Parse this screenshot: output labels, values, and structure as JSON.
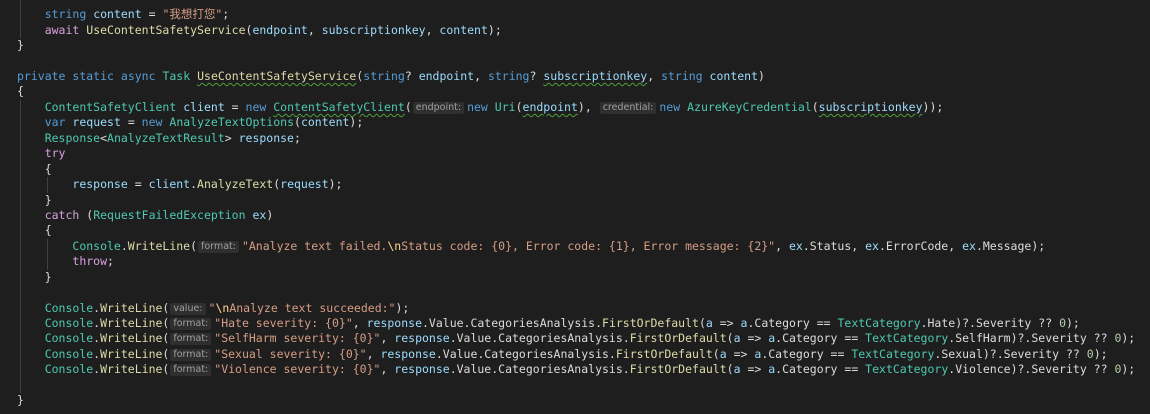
{
  "theme": {
    "background": "#1E1E1E",
    "indent_guide": "#404040",
    "hint_background": "#2F2F2F",
    "hint_text": "#A0A0A0"
  },
  "code": {
    "lines": [
      {
        "tokens": [
          {
            "t": "    ",
            "c": "#DCDCDC"
          },
          {
            "t": "string",
            "c": "#569CD6"
          },
          {
            "t": " ",
            "c": "#DCDCDC"
          },
          {
            "t": "content",
            "c": "#9CDCFE"
          },
          {
            "t": " = ",
            "c": "#DCDCDC"
          },
          {
            "t": "\"我想打您\"",
            "c": "#D69D85"
          },
          {
            "t": ";",
            "c": "#DCDCDC"
          }
        ]
      },
      {
        "tokens": [
          {
            "t": "    ",
            "c": "#DCDCDC"
          },
          {
            "t": "await",
            "c": "#D8A0DF"
          },
          {
            "t": " ",
            "c": "#DCDCDC"
          },
          {
            "t": "UseContentSafetyService",
            "c": "#DCDCAA"
          },
          {
            "t": "(",
            "c": "#DCDCDC"
          },
          {
            "t": "endpoint",
            "c": "#9CDCFE"
          },
          {
            "t": ", ",
            "c": "#DCDCDC"
          },
          {
            "t": "subscriptionkey",
            "c": "#9CDCFE"
          },
          {
            "t": ", ",
            "c": "#DCDCDC"
          },
          {
            "t": "content",
            "c": "#9CDCFE"
          },
          {
            "t": ");",
            "c": "#DCDCDC"
          }
        ]
      },
      {
        "tokens": [
          {
            "t": "}",
            "c": "#DCDCDC"
          }
        ]
      },
      {
        "tokens": []
      },
      {
        "tokens": [
          {
            "t": "private",
            "c": "#569CD6"
          },
          {
            "t": " ",
            "c": "#DCDCDC"
          },
          {
            "t": "static",
            "c": "#569CD6"
          },
          {
            "t": " ",
            "c": "#DCDCDC"
          },
          {
            "t": "async",
            "c": "#569CD6"
          },
          {
            "t": " ",
            "c": "#DCDCDC"
          },
          {
            "t": "Task",
            "c": "#4EC9B0"
          },
          {
            "t": " ",
            "c": "#DCDCDC"
          },
          {
            "t": "UseContentSafetyService",
            "c": "#DCDCAA",
            "u": "#4CA03B"
          },
          {
            "t": "(",
            "c": "#DCDCDC"
          },
          {
            "t": "string",
            "c": "#569CD6"
          },
          {
            "t": "? ",
            "c": "#DCDCDC"
          },
          {
            "t": "endpoint",
            "c": "#9CDCFE"
          },
          {
            "t": ", ",
            "c": "#DCDCDC"
          },
          {
            "t": "string",
            "c": "#569CD6"
          },
          {
            "t": "? ",
            "c": "#DCDCDC"
          },
          {
            "t": "subscriptionkey",
            "c": "#9CDCFE",
            "u": "#4CA03B"
          },
          {
            "t": ", ",
            "c": "#DCDCDC"
          },
          {
            "t": "string",
            "c": "#569CD6"
          },
          {
            "t": " ",
            "c": "#DCDCDC"
          },
          {
            "t": "content",
            "c": "#9CDCFE"
          },
          {
            "t": ")",
            "c": "#DCDCDC"
          }
        ]
      },
      {
        "tokens": [
          {
            "t": "{",
            "c": "#DCDCDC"
          }
        ]
      },
      {
        "tokens": [
          {
            "t": "    ",
            "c": "#DCDCDC"
          },
          {
            "t": "ContentSafetyClient",
            "c": "#4EC9B0"
          },
          {
            "t": " ",
            "c": "#DCDCDC"
          },
          {
            "t": "client",
            "c": "#9CDCFE"
          },
          {
            "t": " = ",
            "c": "#DCDCDC"
          },
          {
            "t": "new",
            "c": "#569CD6"
          },
          {
            "t": " ",
            "c": "#DCDCDC"
          },
          {
            "t": "ContentSafetyClient",
            "c": "#4EC9B0",
            "u": "#4CA03B"
          },
          {
            "t": "(",
            "c": "#DCDCDC"
          },
          {
            "h": "endpoint:"
          },
          {
            "t": "new",
            "c": "#569CD6"
          },
          {
            "t": " ",
            "c": "#DCDCDC"
          },
          {
            "t": "Uri",
            "c": "#4EC9B0"
          },
          {
            "t": "(",
            "c": "#DCDCDC"
          },
          {
            "t": "endpoint",
            "c": "#9CDCFE",
            "u": "#4CA03B"
          },
          {
            "t": "), ",
            "c": "#DCDCDC"
          },
          {
            "h": "credential:"
          },
          {
            "t": "new",
            "c": "#569CD6"
          },
          {
            "t": " ",
            "c": "#DCDCDC"
          },
          {
            "t": "AzureKeyCredential",
            "c": "#4EC9B0"
          },
          {
            "t": "(",
            "c": "#DCDCDC"
          },
          {
            "t": "subscriptionkey",
            "c": "#9CDCFE",
            "u": "#4CA03B"
          },
          {
            "t": "));",
            "c": "#DCDCDC"
          }
        ]
      },
      {
        "tokens": [
          {
            "t": "    ",
            "c": "#DCDCDC"
          },
          {
            "t": "var",
            "c": "#569CD6"
          },
          {
            "t": " ",
            "c": "#DCDCDC"
          },
          {
            "t": "request",
            "c": "#9CDCFE"
          },
          {
            "t": " = ",
            "c": "#DCDCDC"
          },
          {
            "t": "new",
            "c": "#569CD6"
          },
          {
            "t": " ",
            "c": "#DCDCDC"
          },
          {
            "t": "AnalyzeTextOptions",
            "c": "#4EC9B0"
          },
          {
            "t": "(",
            "c": "#DCDCDC"
          },
          {
            "t": "content",
            "c": "#9CDCFE"
          },
          {
            "t": ");",
            "c": "#DCDCDC"
          }
        ]
      },
      {
        "tokens": [
          {
            "t": "    ",
            "c": "#DCDCDC"
          },
          {
            "t": "Response",
            "c": "#4EC9B0"
          },
          {
            "t": "<",
            "c": "#DCDCDC"
          },
          {
            "t": "AnalyzeTextResult",
            "c": "#4EC9B0"
          },
          {
            "t": "> ",
            "c": "#DCDCDC"
          },
          {
            "t": "response",
            "c": "#9CDCFE"
          },
          {
            "t": ";",
            "c": "#DCDCDC"
          }
        ]
      },
      {
        "tokens": [
          {
            "t": "    ",
            "c": "#DCDCDC"
          },
          {
            "t": "try",
            "c": "#D8A0DF"
          }
        ]
      },
      {
        "tokens": [
          {
            "t": "    {",
            "c": "#DCDCDC"
          }
        ]
      },
      {
        "tokens": [
          {
            "t": "        ",
            "c": "#DCDCDC"
          },
          {
            "t": "response",
            "c": "#9CDCFE"
          },
          {
            "t": " = ",
            "c": "#DCDCDC"
          },
          {
            "t": "client",
            "c": "#9CDCFE"
          },
          {
            "t": ".",
            "c": "#DCDCDC"
          },
          {
            "t": "AnalyzeText",
            "c": "#DCDCAA"
          },
          {
            "t": "(",
            "c": "#DCDCDC"
          },
          {
            "t": "request",
            "c": "#9CDCFE"
          },
          {
            "t": ");",
            "c": "#DCDCDC"
          }
        ]
      },
      {
        "tokens": [
          {
            "t": "    }",
            "c": "#DCDCDC"
          }
        ]
      },
      {
        "tokens": [
          {
            "t": "    ",
            "c": "#DCDCDC"
          },
          {
            "t": "catch",
            "c": "#D8A0DF"
          },
          {
            "t": " (",
            "c": "#DCDCDC"
          },
          {
            "t": "RequestFailedException",
            "c": "#4EC9B0"
          },
          {
            "t": " ",
            "c": "#DCDCDC"
          },
          {
            "t": "ex",
            "c": "#9CDCFE"
          },
          {
            "t": ")",
            "c": "#DCDCDC"
          }
        ]
      },
      {
        "tokens": [
          {
            "t": "    {",
            "c": "#DCDCDC"
          }
        ]
      },
      {
        "tokens": [
          {
            "t": "        ",
            "c": "#DCDCDC"
          },
          {
            "t": "Console",
            "c": "#4EC9B0"
          },
          {
            "t": ".",
            "c": "#DCDCDC"
          },
          {
            "t": "WriteLine",
            "c": "#DCDCAA"
          },
          {
            "t": "(",
            "c": "#DCDCDC"
          },
          {
            "h": "format:"
          },
          {
            "t": "\"Analyze text failed.",
            "c": "#D69D85"
          },
          {
            "t": "\\n",
            "c": "#FFD68F"
          },
          {
            "t": "Status code: {0}, Error code: {1}, Error message: {2}\"",
            "c": "#D69D85"
          },
          {
            "t": ", ",
            "c": "#DCDCDC"
          },
          {
            "t": "ex",
            "c": "#9CDCFE"
          },
          {
            "t": ".Status, ",
            "c": "#DCDCDC"
          },
          {
            "t": "ex",
            "c": "#9CDCFE"
          },
          {
            "t": ".ErrorCode, ",
            "c": "#DCDCDC"
          },
          {
            "t": "ex",
            "c": "#9CDCFE"
          },
          {
            "t": ".Message);",
            "c": "#DCDCDC"
          }
        ]
      },
      {
        "tokens": [
          {
            "t": "        ",
            "c": "#DCDCDC"
          },
          {
            "t": "throw",
            "c": "#D8A0DF"
          },
          {
            "t": ";",
            "c": "#DCDCDC"
          }
        ]
      },
      {
        "tokens": [
          {
            "t": "    }",
            "c": "#DCDCDC"
          }
        ]
      },
      {
        "tokens": []
      },
      {
        "tokens": [
          {
            "t": "    ",
            "c": "#DCDCDC"
          },
          {
            "t": "Console",
            "c": "#4EC9B0"
          },
          {
            "t": ".",
            "c": "#DCDCDC"
          },
          {
            "t": "WriteLine",
            "c": "#DCDCAA"
          },
          {
            "t": "(",
            "c": "#DCDCDC"
          },
          {
            "h": "value:"
          },
          {
            "t": "\"",
            "c": "#D69D85"
          },
          {
            "t": "\\n",
            "c": "#FFD68F"
          },
          {
            "t": "Analyze text succeeded:\"",
            "c": "#D69D85"
          },
          {
            "t": ");",
            "c": "#DCDCDC"
          }
        ]
      },
      {
        "tokens": [
          {
            "t": "    ",
            "c": "#DCDCDC"
          },
          {
            "t": "Console",
            "c": "#4EC9B0"
          },
          {
            "t": ".",
            "c": "#DCDCDC"
          },
          {
            "t": "WriteLine",
            "c": "#DCDCAA"
          },
          {
            "t": "(",
            "c": "#DCDCDC"
          },
          {
            "h": "format:"
          },
          {
            "t": "\"Hate severity: {0}\"",
            "c": "#D69D85"
          },
          {
            "t": ", ",
            "c": "#DCDCDC"
          },
          {
            "t": "response",
            "c": "#9CDCFE"
          },
          {
            "t": ".Value.CategoriesAnalysis.",
            "c": "#DCDCDC"
          },
          {
            "t": "FirstOrDefault",
            "c": "#DCDCAA"
          },
          {
            "t": "(",
            "c": "#DCDCDC"
          },
          {
            "t": "a",
            "c": "#9CDCFE"
          },
          {
            "t": " => ",
            "c": "#DCDCDC"
          },
          {
            "t": "a",
            "c": "#9CDCFE"
          },
          {
            "t": ".Category == ",
            "c": "#DCDCDC"
          },
          {
            "t": "TextCategory",
            "c": "#4EC9B0"
          },
          {
            "t": ".Hate)?.Severity ?? ",
            "c": "#DCDCDC"
          },
          {
            "t": "0",
            "c": "#B5CEA8"
          },
          {
            "t": ");",
            "c": "#DCDCDC"
          }
        ]
      },
      {
        "tokens": [
          {
            "t": "    ",
            "c": "#DCDCDC"
          },
          {
            "t": "Console",
            "c": "#4EC9B0"
          },
          {
            "t": ".",
            "c": "#DCDCDC"
          },
          {
            "t": "WriteLine",
            "c": "#DCDCAA"
          },
          {
            "t": "(",
            "c": "#DCDCDC"
          },
          {
            "h": "format:"
          },
          {
            "t": "\"SelfHarm severity: {0}\"",
            "c": "#D69D85"
          },
          {
            "t": ", ",
            "c": "#DCDCDC"
          },
          {
            "t": "response",
            "c": "#9CDCFE"
          },
          {
            "t": ".Value.CategoriesAnalysis.",
            "c": "#DCDCDC"
          },
          {
            "t": "FirstOrDefault",
            "c": "#DCDCAA"
          },
          {
            "t": "(",
            "c": "#DCDCDC"
          },
          {
            "t": "a",
            "c": "#9CDCFE"
          },
          {
            "t": " => ",
            "c": "#DCDCDC"
          },
          {
            "t": "a",
            "c": "#9CDCFE"
          },
          {
            "t": ".Category == ",
            "c": "#DCDCDC"
          },
          {
            "t": "TextCategory",
            "c": "#4EC9B0"
          },
          {
            "t": ".SelfHarm)?.Severity ?? ",
            "c": "#DCDCDC"
          },
          {
            "t": "0",
            "c": "#B5CEA8"
          },
          {
            "t": ");",
            "c": "#DCDCDC"
          }
        ]
      },
      {
        "tokens": [
          {
            "t": "    ",
            "c": "#DCDCDC"
          },
          {
            "t": "Console",
            "c": "#4EC9B0"
          },
          {
            "t": ".",
            "c": "#DCDCDC"
          },
          {
            "t": "WriteLine",
            "c": "#DCDCAA"
          },
          {
            "t": "(",
            "c": "#DCDCDC"
          },
          {
            "h": "format:"
          },
          {
            "t": "\"Sexual severity: {0}\"",
            "c": "#D69D85"
          },
          {
            "t": ", ",
            "c": "#DCDCDC"
          },
          {
            "t": "response",
            "c": "#9CDCFE"
          },
          {
            "t": ".Value.CategoriesAnalysis.",
            "c": "#DCDCDC"
          },
          {
            "t": "FirstOrDefault",
            "c": "#DCDCAA"
          },
          {
            "t": "(",
            "c": "#DCDCDC"
          },
          {
            "t": "a",
            "c": "#9CDCFE"
          },
          {
            "t": " => ",
            "c": "#DCDCDC"
          },
          {
            "t": "a",
            "c": "#9CDCFE"
          },
          {
            "t": ".Category == ",
            "c": "#DCDCDC"
          },
          {
            "t": "TextCategory",
            "c": "#4EC9B0"
          },
          {
            "t": ".Sexual)?.Severity ?? ",
            "c": "#DCDCDC"
          },
          {
            "t": "0",
            "c": "#B5CEA8"
          },
          {
            "t": ");",
            "c": "#DCDCDC"
          }
        ]
      },
      {
        "tokens": [
          {
            "t": "    ",
            "c": "#DCDCDC"
          },
          {
            "t": "Console",
            "c": "#4EC9B0"
          },
          {
            "t": ".",
            "c": "#DCDCDC"
          },
          {
            "t": "WriteLine",
            "c": "#DCDCAA"
          },
          {
            "t": "(",
            "c": "#DCDCDC"
          },
          {
            "h": "format:"
          },
          {
            "t": "\"Violence severity: {0}\"",
            "c": "#D69D85"
          },
          {
            "t": ", ",
            "c": "#DCDCDC"
          },
          {
            "t": "response",
            "c": "#9CDCFE"
          },
          {
            "t": ".Value.CategoriesAnalysis.",
            "c": "#DCDCDC"
          },
          {
            "t": "FirstOrDefault",
            "c": "#DCDCAA"
          },
          {
            "t": "(",
            "c": "#DCDCDC"
          },
          {
            "t": "a",
            "c": "#9CDCFE"
          },
          {
            "t": " => ",
            "c": "#DCDCDC"
          },
          {
            "t": "a",
            "c": "#9CDCFE"
          },
          {
            "t": ".Category == ",
            "c": "#DCDCDC"
          },
          {
            "t": "TextCategory",
            "c": "#4EC9B0"
          },
          {
            "t": ".Violence)?.Severity ?? ",
            "c": "#DCDCDC"
          },
          {
            "t": "0",
            "c": "#B5CEA8"
          },
          {
            "t": ");",
            "c": "#DCDCDC"
          }
        ]
      },
      {
        "tokens": []
      },
      {
        "tokens": [
          {
            "t": "}",
            "c": "#DCDCDC"
          }
        ]
      }
    ]
  }
}
